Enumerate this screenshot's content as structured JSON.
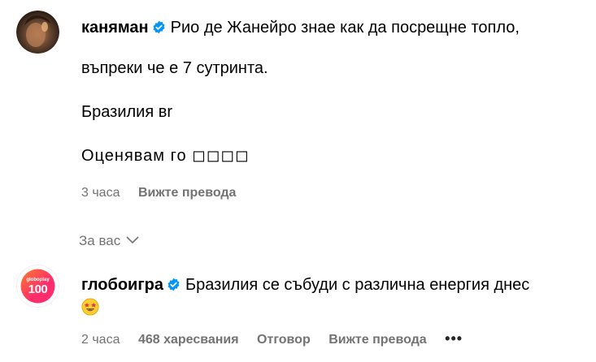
{
  "comment1": {
    "username": "каняман",
    "lines": [
      "Рио де Жанейро знае как да посрещне топло,",
      "въпреки че е 7 сутринта.",
      "Бразилия вr",
      "Оценявам го ◻◻◻◻"
    ],
    "time": "3 часа",
    "translate": "Вижте превода"
  },
  "for_you": "За вас",
  "comment2": {
    "username": "глобоигра",
    "avatar_text": "globoplay",
    "avatar_number": "100",
    "text": "Бразилия се събуди с различна енергия днес",
    "time": "2 часа",
    "likes": "468 харесвания",
    "reply": "Отговор",
    "translate": "Вижте превода"
  },
  "colors": {
    "verified": "#0095f6",
    "meta": "#737373",
    "globoplay_pink": "#ff2d6b",
    "globoplay_orange": "#ff7a2a"
  },
  "icons": [
    "verified-badge-icon",
    "chevron-down-icon",
    "star-struck-emoji-icon",
    "more-options-icon"
  ]
}
